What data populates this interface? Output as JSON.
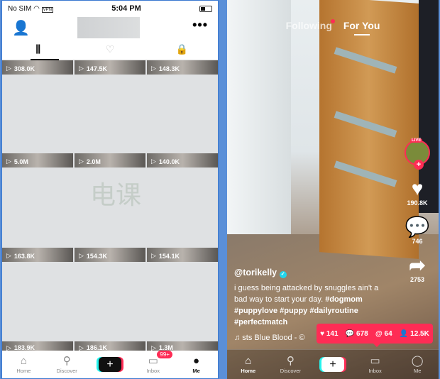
{
  "left": {
    "status": {
      "carrier": "No SIM",
      "vpn": "VPN",
      "time": "5:04 PM"
    },
    "header": {
      "add_user_icon": "person-plus-icon",
      "more": "•••"
    },
    "tabs": [
      "⫼",
      "♡",
      "🔒"
    ],
    "grid": [
      [
        "308.0K",
        "147.5K",
        "148.3K"
      ],
      [
        "5.0M",
        "2.0M",
        "140.0K"
      ],
      [
        "163.8K",
        "154.3K",
        "154.1K"
      ],
      [
        "183.9K",
        "186.1K",
        "1.3M"
      ]
    ],
    "nav": [
      {
        "label": "Home",
        "icon": "⌂"
      },
      {
        "label": "Discover",
        "icon": "⚲"
      },
      {
        "label": "",
        "icon": "+"
      },
      {
        "label": "Inbox",
        "icon": "▭",
        "badge": "99+"
      },
      {
        "label": "Me",
        "icon": "●"
      }
    ]
  },
  "right": {
    "top": {
      "following": "Following",
      "for_you": "For You"
    },
    "side": {
      "live": "LIVE",
      "likes": "190.8K",
      "comments": "746",
      "shares": "2753"
    },
    "caption": {
      "user": "@torikelly",
      "text": "i guess being attacked by snuggles ain't a bad way to start your day.",
      "tags": "#dogmom #puppylove #puppy #dailyroutine #perfectmatch"
    },
    "music": "♫  sts    Blue Blood - ©",
    "stats": {
      "likes": "141",
      "comments": "678",
      "mentions": "64",
      "followers": "12.5K"
    },
    "nav": [
      {
        "label": "Home",
        "icon": "⌂"
      },
      {
        "label": "Discover",
        "icon": "⚲"
      },
      {
        "label": "",
        "icon": "+"
      },
      {
        "label": "Inbox",
        "icon": "▭"
      },
      {
        "label": "Me",
        "icon": "◯"
      }
    ]
  },
  "colors": {
    "accent": "#fe2c55",
    "cyan": "#25f4ee"
  }
}
